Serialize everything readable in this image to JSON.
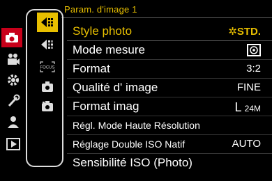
{
  "header": {
    "title": "Param. d'image 1"
  },
  "main_tabs": [
    {
      "icon": "camera-icon",
      "active": true
    },
    {
      "icon": "video-camera-icon",
      "active": false
    },
    {
      "icon": "gear-icon",
      "active": false
    },
    {
      "icon": "wrench-icon",
      "active": false
    },
    {
      "icon": "custom-user-icon",
      "active": false
    },
    {
      "icon": "playback-icon",
      "active": false
    }
  ],
  "sub_tabs": [
    {
      "icon": "image-settings-1-icon",
      "active": true
    },
    {
      "icon": "image-settings-2-icon",
      "active": false
    },
    {
      "icon": "focus-icon",
      "active": false
    },
    {
      "icon": "camera-settings-icon",
      "active": false
    },
    {
      "icon": "camera-settings-2-icon",
      "active": false
    }
  ],
  "sub_tab_focus_label": "FOCUS",
  "menu": {
    "items": [
      {
        "label": "Style photo",
        "value": "STD.",
        "selected": true
      },
      {
        "label": "Mode mesure",
        "value": "",
        "selected": false
      },
      {
        "label": "Format",
        "value": "3:2",
        "selected": false
      },
      {
        "label": "Qualité d' image",
        "value": "FINE",
        "selected": false
      },
      {
        "label": "Format imag",
        "value": "L",
        "value_sub": "24M",
        "selected": false
      },
      {
        "label": "Régl. Mode Haute Résolution",
        "value": "",
        "selected": false
      },
      {
        "label": "Réglage Double ISO Natif",
        "value": "AUTO",
        "selected": false
      },
      {
        "label": "Sensibilité ISO (Photo)",
        "value": "",
        "selected": false
      }
    ]
  },
  "colors": {
    "accent": "#e8bf00",
    "tab_red": "#c8001a",
    "frame": "#dddddd"
  }
}
